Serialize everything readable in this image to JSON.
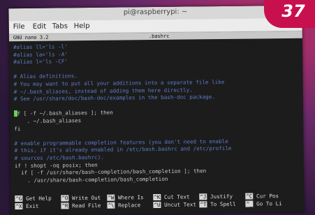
{
  "window": {
    "title": "pi@raspberrypi: ~"
  },
  "menu": [
    "File",
    "Edit",
    "Tabs",
    "Help"
  ],
  "nano": {
    "version": "GNU nano 3.2",
    "filename": ".bashrc"
  },
  "lines": [
    {
      "text": "#alias ll='ls -l'",
      "kind": "comment"
    },
    {
      "text": "#alias la='ls -A'",
      "kind": "comment"
    },
    {
      "text": "#alias l='ls -CF'",
      "kind": "comment"
    },
    {
      "text": "",
      "kind": "code"
    },
    {
      "text": "# Alias definitions.",
      "kind": "comment"
    },
    {
      "text": "# You may want to put all your additions into a separate file like",
      "kind": "comment"
    },
    {
      "text": "# ~/.bash_aliases, instead of adding them here directly.",
      "kind": "comment"
    },
    {
      "text": "# See /usr/share/doc/bash-doc/examples in the bash-doc package.",
      "kind": "comment"
    },
    {
      "text": "",
      "kind": "code"
    },
    {
      "text": "if [ -f ~/.bash_aliases ]; then",
      "kind": "cursor"
    },
    {
      "text": "    . ~/.bash_aliases",
      "kind": "code"
    },
    {
      "text": "fi",
      "kind": "code"
    },
    {
      "text": "",
      "kind": "code"
    },
    {
      "text": "# enable programmable completion features (you don't need to enable",
      "kind": "comment"
    },
    {
      "text": "# this, if it's already enabled in /etc/bash.bashrc and /etc/profile",
      "kind": "comment"
    },
    {
      "text": "# sources /etc/bash.bashrc).",
      "kind": "comment"
    },
    {
      "text": "if ! shopt -oq posix; then",
      "kind": "code"
    },
    {
      "text": "  if [ -f /usr/share/bash-completion/bash_completion ]; then",
      "kind": "code"
    },
    {
      "text": "    . /usr/share/bash-completion/bash_completion",
      "kind": "code"
    }
  ],
  "shortcuts_row1": [
    {
      "key": "^G",
      "label": "Get Help"
    },
    {
      "key": "^O",
      "label": "Write Out"
    },
    {
      "key": "^W",
      "label": "Where Is"
    },
    {
      "key": "^K",
      "label": "Cut Text"
    },
    {
      "key": "^J",
      "label": "Justify"
    },
    {
      "key": "^C",
      "label": "Cur Pos"
    }
  ],
  "shortcuts_row2": [
    {
      "key": "^X",
      "label": "Exit"
    },
    {
      "key": "^R",
      "label": "Read File"
    },
    {
      "key": "^\\",
      "label": "Replace"
    },
    {
      "key": "^U",
      "label": "Uncut Text"
    },
    {
      "key": "^T",
      "label": "To Spell"
    },
    {
      "key": "^_",
      "label": "Go To Li"
    }
  ],
  "badge": {
    "number": "37"
  }
}
